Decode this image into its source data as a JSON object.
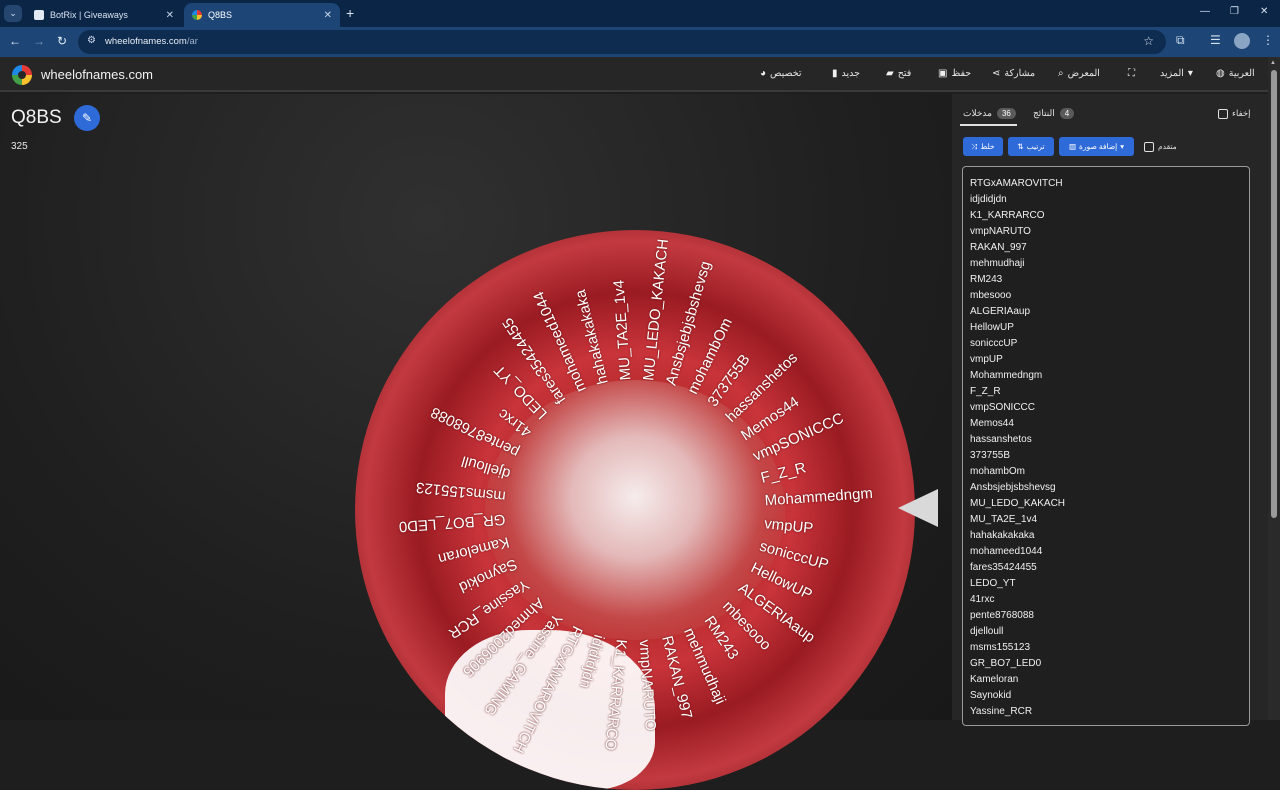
{
  "browser": {
    "tabs": [
      {
        "title": "BotRix | Giveaways",
        "active": false
      },
      {
        "title": "Q8BS",
        "active": true
      }
    ],
    "url_host": "wheelofnames.com",
    "url_path": "/ar"
  },
  "app": {
    "logo_text": "wheelofnames.com",
    "menu": [
      {
        "label": "تخصيص",
        "icon": "palette-icon"
      },
      {
        "label": "جديد",
        "icon": "new-file-icon"
      },
      {
        "label": "فتح",
        "icon": "folder-open-icon"
      },
      {
        "label": "حفظ",
        "icon": "save-icon"
      },
      {
        "label": "مشاركة",
        "icon": "share-icon"
      },
      {
        "label": "المعرض",
        "icon": "search-icon"
      },
      {
        "label": "",
        "icon": "fullscreen-icon"
      },
      {
        "label": "المزيد",
        "icon": "chevron-down-icon"
      },
      {
        "label": "العربية",
        "icon": "globe-icon"
      }
    ]
  },
  "main": {
    "title": "Q8BS",
    "count": "325"
  },
  "panel": {
    "tab_entries": {
      "label": "مدخلات",
      "count": "36"
    },
    "tab_results": {
      "label": "النتائج",
      "count": "4"
    },
    "hide_label": "إخفاء",
    "buttons": {
      "shuffle": "خلط",
      "sort": "ترتيب",
      "add_image": "إضافة صورة"
    },
    "advanced_label": "متقدم",
    "entries": [
      "RTGxAMAROVITCH",
      "idjdidjdn",
      "K1_KARRARCO",
      "vmpNARUTO",
      "RAKAN_997",
      "mehmudhaji",
      "RM243",
      "mbesooo",
      "ALGERIAaup",
      "HellowUP",
      "sonicccUP",
      "vmpUP",
      "Mohammedngm",
      "F_Z_R",
      "vmpSONICCC",
      "Memos44",
      "hassanshetos",
      "373755B",
      "mohambOm",
      "Ansbsjebjsbshevsg",
      "MU_LEDO_KAKACH",
      "MU_TA2E_1v4",
      "hahakakakaka",
      "mohameed1044",
      "fares35424455",
      "LEDO_YT",
      "41rxc",
      "pente8768088",
      "djelloull",
      "msms155123",
      "GR_BO7_LED0",
      "Kameloran",
      "Saynokid",
      "Yassine_RCR"
    ]
  },
  "wheel": {
    "names": [
      "Mohammedngm",
      "vmpUP",
      "sonicccUP",
      "HellowUP",
      "ALGERIAaup",
      "mbesooo",
      "RM243",
      "mehmudhaji",
      "RAKAN_997",
      "vmpNARUTO",
      "K1_KARRARCO",
      "idjdidjdn",
      "RTGxAMAROVITCH",
      "Yassine_GAMING",
      "Ahmed2006905",
      "Yassine_RCR",
      "Saynokid",
      "Kameloran",
      "GR_BO7_LED0",
      "msms155123",
      "djelloull",
      "pente8768088",
      "41rxc",
      "LEDO_YT",
      "fares35424455",
      "mohameed1044",
      "hahakakakaka",
      "MU_TA2E_1v4",
      "MU_LEDO_KAKACH",
      "Ansbsjebjsbshevsg",
      "mohambOm",
      "373755B",
      "hassanshetos",
      "Memos44",
      "vmpSONICCC",
      "F_Z_R"
    ]
  }
}
